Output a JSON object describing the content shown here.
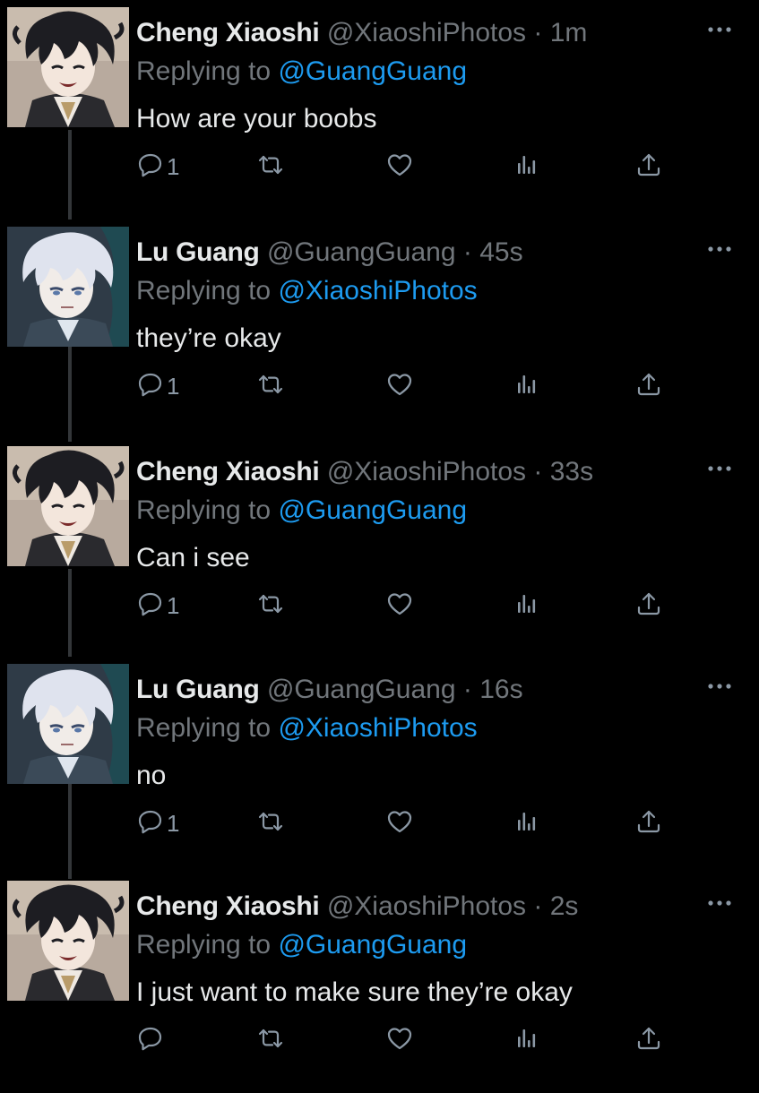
{
  "tweets": [
    {
      "author": "cheng",
      "name": "Cheng Xiaoshi",
      "handle": "@XiaoshiPhotos",
      "separator": "·",
      "time": "1m",
      "replying_prefix": "Replying to ",
      "replying_to": "@GuangGuang",
      "text": "How are your boobs",
      "reply_count": "1"
    },
    {
      "author": "lu",
      "name": "Lu Guang",
      "handle": "@GuangGuang",
      "separator": "·",
      "time": "45s",
      "replying_prefix": "Replying to ",
      "replying_to": "@XiaoshiPhotos",
      "text": "they’re okay",
      "reply_count": "1"
    },
    {
      "author": "cheng",
      "name": "Cheng Xiaoshi",
      "handle": "@XiaoshiPhotos",
      "separator": "·",
      "time": "33s",
      "replying_prefix": "Replying to ",
      "replying_to": "@GuangGuang",
      "text": "Can i see",
      "reply_count": "1"
    },
    {
      "author": "lu",
      "name": "Lu Guang",
      "handle": "@GuangGuang",
      "separator": "·",
      "time": "16s",
      "replying_prefix": "Replying to ",
      "replying_to": "@XiaoshiPhotos",
      "text": "no",
      "reply_count": "1"
    },
    {
      "author": "cheng",
      "name": "Cheng Xiaoshi",
      "handle": "@XiaoshiPhotos",
      "separator": "·",
      "time": "2s",
      "replying_prefix": "Replying to ",
      "replying_to": "@GuangGuang",
      "text": "I just want to make sure they’re okay",
      "reply_count": ""
    }
  ],
  "icons": {
    "reply": "reply-icon",
    "retweet": "retweet-icon",
    "like": "heart-icon",
    "views": "views-icon",
    "share": "share-icon",
    "more": "more-icon"
  },
  "colors": {
    "background": "#000000",
    "text": "#e7e9ea",
    "muted": "#71767b",
    "link": "#1d9bf0",
    "thread_line": "#333639"
  }
}
